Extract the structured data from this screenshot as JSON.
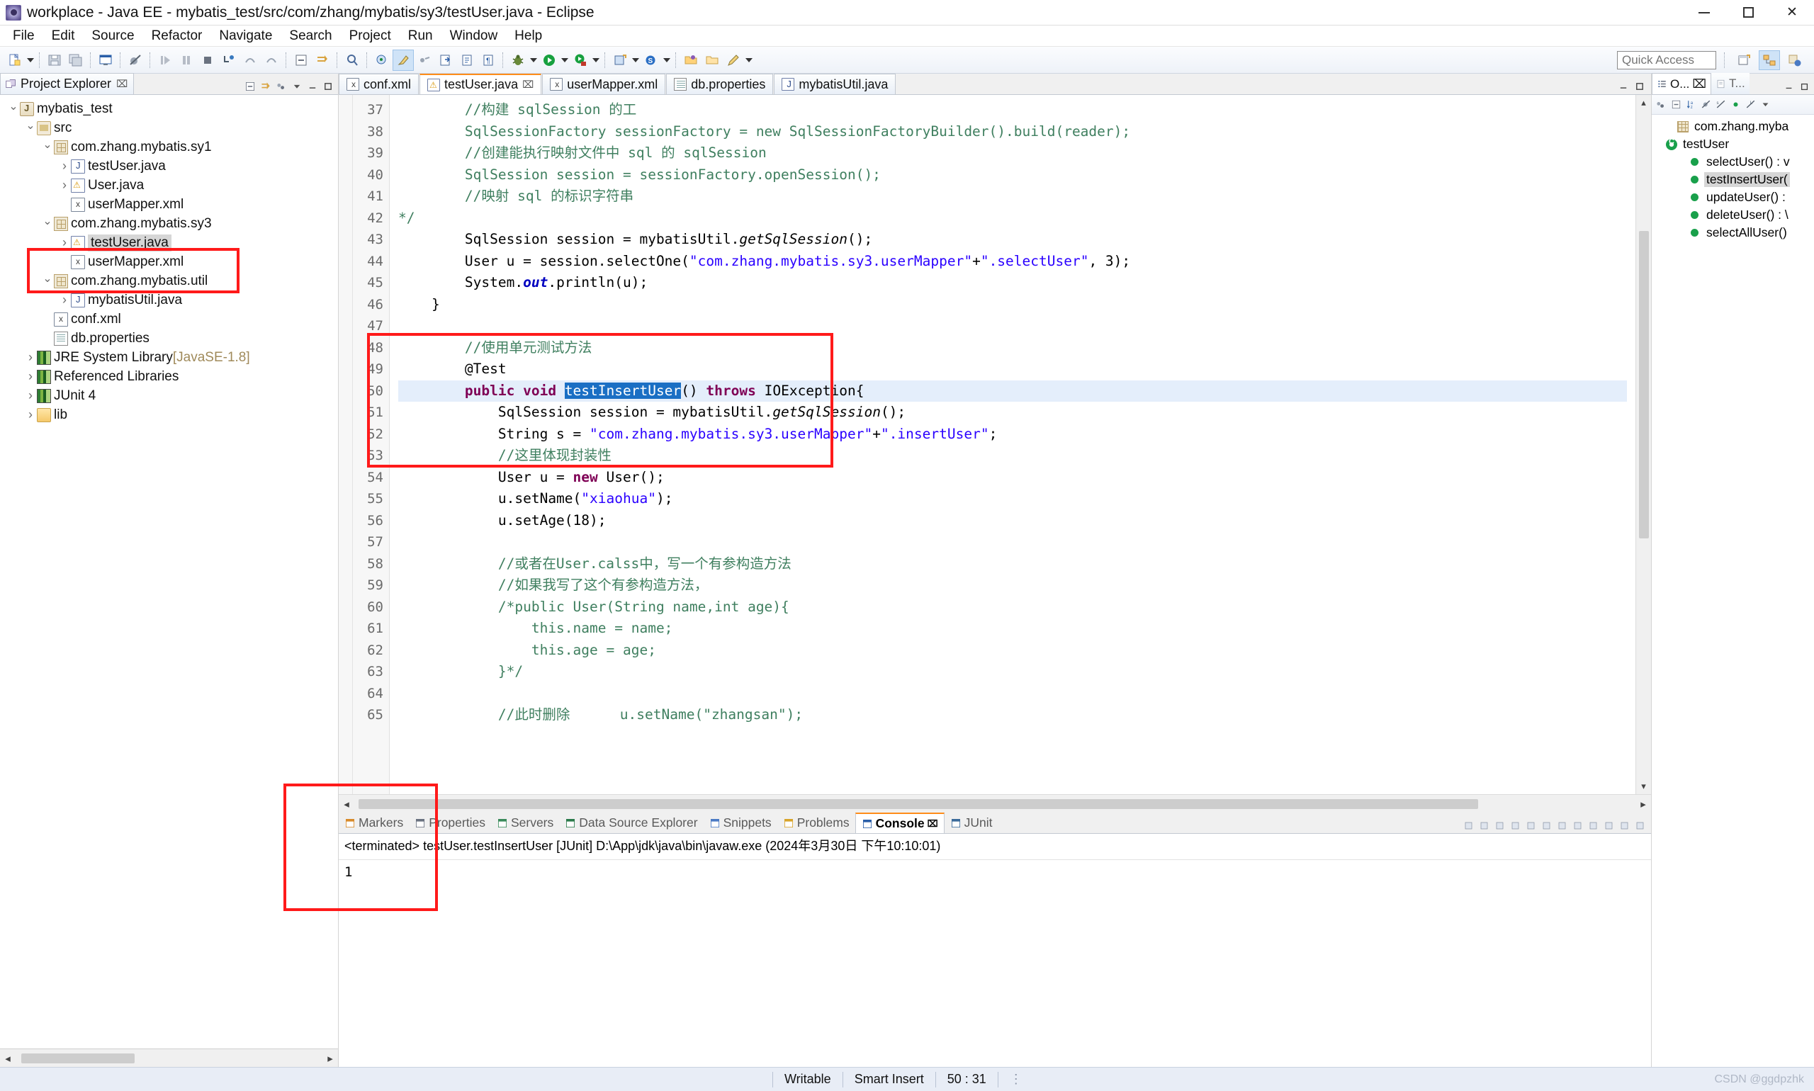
{
  "window": {
    "title": "workplace - Java EE - mybatis_test/src/com/zhang/mybatis/sy3/testUser.java - Eclipse",
    "icon": "eclipse-icon",
    "minimize_label": "–",
    "maximize_label": "□",
    "close_label": "✕"
  },
  "menu": {
    "items": [
      "File",
      "Edit",
      "Source",
      "Refactor",
      "Navigate",
      "Search",
      "Project",
      "Run",
      "Window",
      "Help"
    ]
  },
  "toolbar": {
    "quick_access_placeholder": "Quick Access",
    "quick_access_value": ""
  },
  "project_explorer": {
    "tab_label": "Project Explorer",
    "close_label": "⌧",
    "items": [
      {
        "label": "mybatis_test",
        "icon": "java-project-icon",
        "indent": 0,
        "arrow": "open",
        "selected": false
      },
      {
        "label": "src",
        "icon": "source-folder-icon",
        "indent": 1,
        "arrow": "open",
        "selected": false
      },
      {
        "label": "com.zhang.mybatis.sy1",
        "icon": "package-icon",
        "indent": 2,
        "arrow": "open",
        "selected": false
      },
      {
        "label": "testUser.java",
        "icon": "java-file-icon",
        "indent": 3,
        "arrow": "closed",
        "selected": false
      },
      {
        "label": "User.java",
        "icon": "java-file-warning-icon",
        "indent": 3,
        "arrow": "closed",
        "selected": false
      },
      {
        "label": "userMapper.xml",
        "icon": "xml-file-icon",
        "indent": 3,
        "arrow": "none",
        "selected": false
      },
      {
        "label": "com.zhang.mybatis.sy3",
        "icon": "package-icon",
        "indent": 2,
        "arrow": "open",
        "selected": false
      },
      {
        "label": "testUser.java",
        "icon": "java-file-warning-icon",
        "indent": 3,
        "arrow": "closed",
        "selected": true
      },
      {
        "label": "userMapper.xml",
        "icon": "xml-file-icon",
        "indent": 3,
        "arrow": "none",
        "selected": false
      },
      {
        "label": "com.zhang.mybatis.util",
        "icon": "package-icon",
        "indent": 2,
        "arrow": "open",
        "selected": false
      },
      {
        "label": "mybatisUtil.java",
        "icon": "java-file-icon",
        "indent": 3,
        "arrow": "closed",
        "selected": false
      },
      {
        "label": "conf.xml",
        "icon": "xml-file-icon",
        "indent": 2,
        "arrow": "none",
        "selected": false
      },
      {
        "label": "db.properties",
        "icon": "properties-file-icon",
        "indent": 2,
        "arrow": "none",
        "selected": false
      },
      {
        "label": "JRE System Library",
        "suffix": "[JavaSE-1.8]",
        "icon": "library-icon",
        "indent": 1,
        "arrow": "closed",
        "selected": false
      },
      {
        "label": "Referenced Libraries",
        "icon": "library-icon",
        "indent": 1,
        "arrow": "closed",
        "selected": false
      },
      {
        "label": "JUnit 4",
        "icon": "library-icon",
        "indent": 1,
        "arrow": "closed",
        "selected": false
      },
      {
        "label": "lib",
        "icon": "folder-icon",
        "indent": 1,
        "arrow": "closed",
        "selected": false
      }
    ]
  },
  "editor": {
    "tabs": [
      {
        "label": "conf.xml",
        "icon": "xml-file-icon",
        "active": false,
        "closeable": false
      },
      {
        "label": "testUser.java",
        "icon": "java-file-warning-icon",
        "active": true,
        "closeable": true
      },
      {
        "label": "userMapper.xml",
        "icon": "xml-file-icon",
        "active": false,
        "closeable": false
      },
      {
        "label": "db.properties",
        "icon": "properties-file-icon",
        "active": false,
        "closeable": false
      },
      {
        "label": "mybatisUtil.java",
        "icon": "java-file-icon",
        "active": false,
        "closeable": false
      }
    ],
    "close_label": "⌧",
    "first_line_number": 37,
    "lines": [
      {
        "n": 37,
        "segments": [
          {
            "t": "        //构建 sqlSession 的工",
            "c": "cmt"
          }
        ]
      },
      {
        "n": 38,
        "segments": [
          {
            "t": "        ",
            "c": ""
          },
          {
            "t": "SqlSessionFactory sessionFactory = new SqlSessionFactoryBuilder().build(reader);",
            "c": "cmt"
          }
        ]
      },
      {
        "n": 39,
        "segments": [
          {
            "t": "        //创建能执行映射文件中 sql 的 sqlSession",
            "c": "cmt"
          }
        ]
      },
      {
        "n": 40,
        "segments": [
          {
            "t": "        ",
            "c": ""
          },
          {
            "t": "SqlSession session = sessionFactory.openSession();",
            "c": "cmt"
          }
        ]
      },
      {
        "n": 41,
        "segments": [
          {
            "t": "        //映射 sql 的标识字符串",
            "c": "cmt"
          }
        ]
      },
      {
        "n": 42,
        "segments": [
          {
            "t": "*/",
            "c": "cmt"
          }
        ],
        "nopad": true
      },
      {
        "n": 43,
        "segments": [
          {
            "t": "        SqlSession session = mybatisUtil.",
            "c": ""
          },
          {
            "t": "getSqlSession",
            "c": "mth"
          },
          {
            "t": "();",
            "c": ""
          }
        ]
      },
      {
        "n": 44,
        "segments": [
          {
            "t": "        User u = session.selectOne(",
            "c": ""
          },
          {
            "t": "\"com.zhang.mybatis.sy3.userMapper\"",
            "c": "str"
          },
          {
            "t": "+",
            "c": ""
          },
          {
            "t": "\".selectUser\"",
            "c": "str"
          },
          {
            "t": ", 3);",
            "c": ""
          }
        ]
      },
      {
        "n": 45,
        "segments": [
          {
            "t": "        System.",
            "c": ""
          },
          {
            "t": "out",
            "c": "fld"
          },
          {
            "t": ".println(u);",
            "c": ""
          }
        ]
      },
      {
        "n": 46,
        "segments": [
          {
            "t": "    }",
            "c": ""
          }
        ]
      },
      {
        "n": 47,
        "segments": [
          {
            "t": "",
            "c": ""
          }
        ]
      },
      {
        "n": 48,
        "segments": [
          {
            "t": "        //使用单元测试方法",
            "c": "cmt"
          }
        ]
      },
      {
        "n": 49,
        "segments": [
          {
            "t": "        @Test",
            "c": ""
          }
        ]
      },
      {
        "n": 50,
        "highlight": true,
        "segments": [
          {
            "t": "        ",
            "c": ""
          },
          {
            "t": "public void ",
            "c": "kw"
          },
          {
            "t": "testInsertUser",
            "c": "sel-tok"
          },
          {
            "t": "() ",
            "c": ""
          },
          {
            "t": "throws ",
            "c": "kw"
          },
          {
            "t": "IOException{",
            "c": ""
          }
        ]
      },
      {
        "n": 51,
        "segments": [
          {
            "t": "            SqlSession session = mybatisUtil.",
            "c": ""
          },
          {
            "t": "getSqlSession",
            "c": "mth"
          },
          {
            "t": "();",
            "c": ""
          }
        ]
      },
      {
        "n": 52,
        "segments": [
          {
            "t": "            String s = ",
            "c": ""
          },
          {
            "t": "\"com.zhang.mybatis.sy3.userMapper\"",
            "c": "str"
          },
          {
            "t": "+",
            "c": ""
          },
          {
            "t": "\".insertUser\"",
            "c": "str"
          },
          {
            "t": ";",
            "c": ""
          }
        ]
      },
      {
        "n": 53,
        "segments": [
          {
            "t": "            //这里体现封装性",
            "c": "cmt"
          }
        ]
      },
      {
        "n": 54,
        "segments": [
          {
            "t": "            User u = ",
            "c": ""
          },
          {
            "t": "new ",
            "c": "kw"
          },
          {
            "t": "User();",
            "c": ""
          }
        ]
      },
      {
        "n": 55,
        "segments": [
          {
            "t": "            u.setName(",
            "c": ""
          },
          {
            "t": "\"xiaohua\"",
            "c": "str"
          },
          {
            "t": ");",
            "c": ""
          }
        ]
      },
      {
        "n": 56,
        "segments": [
          {
            "t": "            u.setAge(18);",
            "c": ""
          }
        ]
      },
      {
        "n": 57,
        "segments": [
          {
            "t": "",
            "c": ""
          }
        ]
      },
      {
        "n": 58,
        "segments": [
          {
            "t": "            //或者在User.calss中，写一个有参构造方法",
            "c": "cmt"
          }
        ]
      },
      {
        "n": 59,
        "segments": [
          {
            "t": "            //如果我写了这个有参构造方法，",
            "c": "cmt"
          }
        ]
      },
      {
        "n": 60,
        "segments": [
          {
            "t": "            /*public User(String name,int age){",
            "c": "cmt"
          }
        ]
      },
      {
        "n": 61,
        "segments": [
          {
            "t": "                this.name = name;",
            "c": "cmt"
          }
        ]
      },
      {
        "n": 62,
        "segments": [
          {
            "t": "                this.age = age;",
            "c": "cmt"
          }
        ]
      },
      {
        "n": 63,
        "segments": [
          {
            "t": "            }*/",
            "c": "cmt"
          }
        ]
      },
      {
        "n": 64,
        "segments": [
          {
            "t": "",
            "c": ""
          }
        ]
      },
      {
        "n": 65,
        "segments": [
          {
            "t": "            //此时删除      u.setName(\"zhangsan\");",
            "c": "cmt"
          }
        ]
      }
    ]
  },
  "console": {
    "tabs": [
      {
        "label": "Markers",
        "icon": "markers-icon",
        "active": false
      },
      {
        "label": "Properties",
        "icon": "properties-icon",
        "active": false
      },
      {
        "label": "Servers",
        "icon": "servers-icon",
        "active": false
      },
      {
        "label": "Data Source Explorer",
        "icon": "data-source-icon",
        "active": false
      },
      {
        "label": "Snippets",
        "icon": "snippets-icon",
        "active": false
      },
      {
        "label": "Problems",
        "icon": "problems-icon",
        "active": false
      },
      {
        "label": "Console",
        "icon": "console-icon",
        "active": true
      },
      {
        "label": "JUnit",
        "icon": "junit-icon",
        "active": false
      }
    ],
    "close_label": "⌧",
    "process_line": "<terminated> testUser.testInsertUser [JUnit] D:\\App\\jdk\\java\\bin\\javaw.exe (2024年3月30日 下午10:10:01)",
    "output": "1"
  },
  "outline": {
    "tabs": [
      {
        "label": "O...",
        "icon": "outline-icon",
        "active": true,
        "closeable": true
      },
      {
        "label": "T...",
        "icon": "task-list-icon",
        "active": false,
        "closeable": false
      }
    ],
    "close_label": "⌧",
    "items": [
      {
        "label": "com.zhang.myba",
        "icon": "package-icon",
        "indent": 1,
        "arrow": "none",
        "kind": "pkg",
        "selected": false
      },
      {
        "label": "testUser",
        "icon": "class-icon",
        "indent": 0,
        "arrow": "open",
        "kind": "cls",
        "selected": false
      },
      {
        "label": "selectUser() : v",
        "icon": "method-icon",
        "indent": 2,
        "arrow": "none",
        "kind": "mth",
        "selected": false
      },
      {
        "label": "testInsertUser(",
        "icon": "method-icon",
        "indent": 2,
        "arrow": "none",
        "kind": "mth",
        "selected": true
      },
      {
        "label": "updateUser() :",
        "icon": "method-icon",
        "indent": 2,
        "arrow": "none",
        "kind": "mth",
        "selected": false
      },
      {
        "label": "deleteUser() : \\",
        "icon": "method-icon",
        "indent": 2,
        "arrow": "none",
        "kind": "mth",
        "selected": false
      },
      {
        "label": "selectAllUser()",
        "icon": "method-icon",
        "indent": 2,
        "arrow": "none",
        "kind": "mth",
        "selected": false
      }
    ]
  },
  "statusbar": {
    "writable": "Writable",
    "insert_mode": "Smart Insert",
    "position": "50 : 31",
    "watermark": "CSDN @ggdpzhk"
  },
  "colors": {
    "annotation_red": "#ff1a1a",
    "selection_blue": "#1a6fc4",
    "line_highlight": "#e4eefb",
    "comment_green": "#3f7f5f",
    "keyword_purple": "#7f0055",
    "string_blue": "#2a00ff",
    "tab_accent": "#ff8c1a"
  }
}
